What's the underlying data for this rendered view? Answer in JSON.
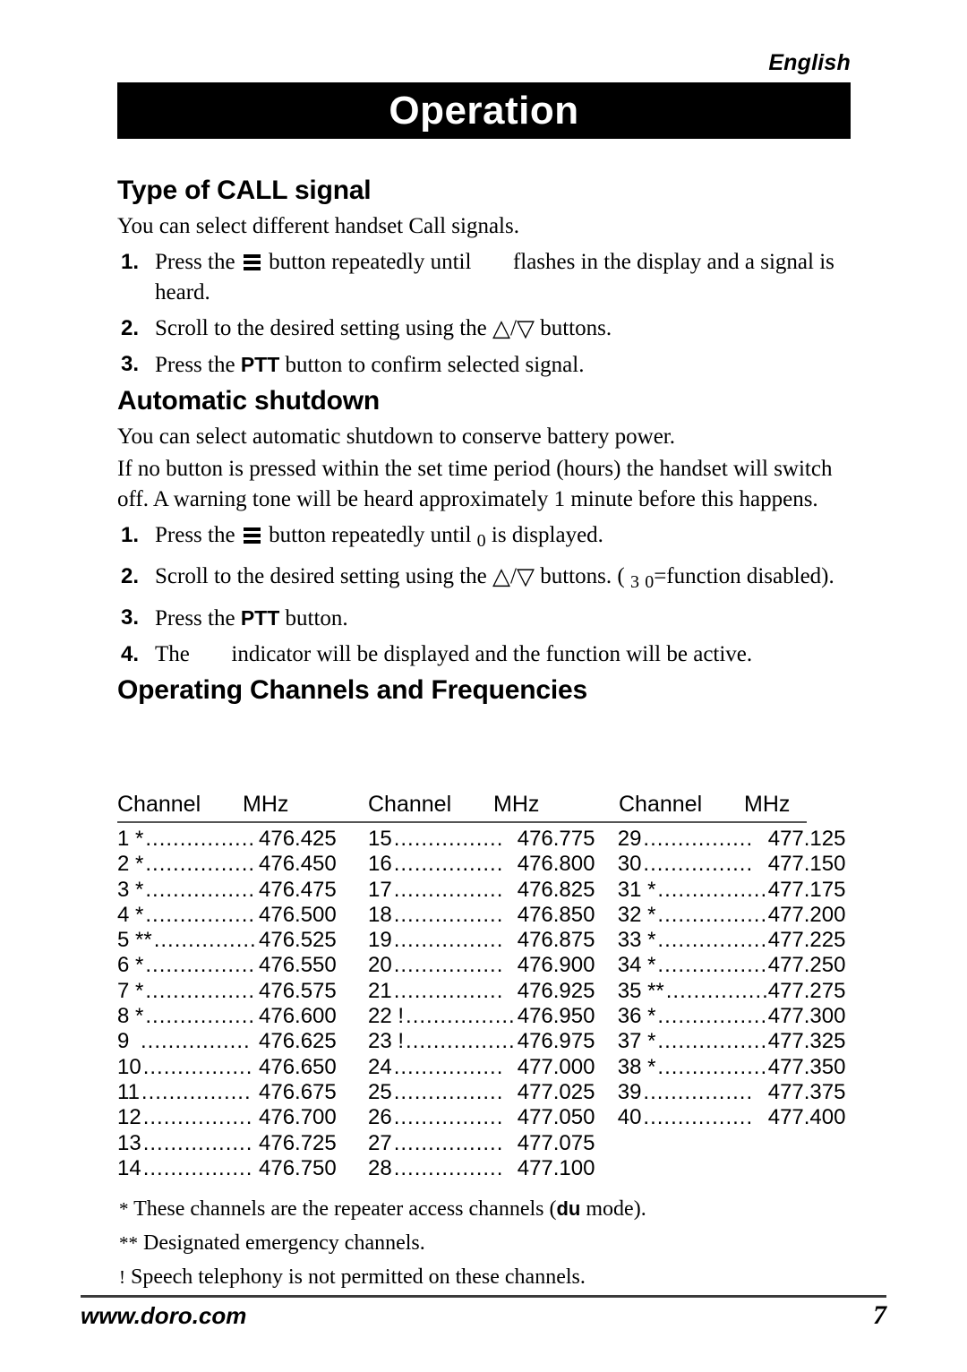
{
  "header": {
    "language_label": "English",
    "banner_title": "Operation"
  },
  "sections": [
    {
      "heading": "Type of CALL signal",
      "intro": "You can select different handset Call signals.",
      "steps": [
        {
          "num": "1.",
          "pre": "Press the",
          "icon": "menu-bars-icon",
          "mid": "button repeatedly until",
          "lcd": "",
          "post": "flashes in the display and a signal is heard."
        },
        {
          "num": "2.",
          "pre": "Scroll to the desired setting using the",
          "up": "△",
          "slash": "/",
          "down": "▽",
          "post": "buttons."
        },
        {
          "num": "3.",
          "pre": "Press the",
          "bold": "PTT",
          "post": "button to confirm selected signal."
        }
      ]
    },
    {
      "heading": "Automatic shutdown",
      "intro": "You can select automatic shutdown to conserve battery power.",
      "intro2": "If no button is pressed within the set time period (hours) the handset will switch off. A warning tone will be heard approximately 1 minute before this happens.",
      "steps": [
        {
          "num": "1.",
          "pre": "Press the",
          "icon": "menu-bars-icon",
          "mid": "button repeatedly until",
          "lcd": "0",
          "post": "is displayed."
        },
        {
          "num": "2.",
          "pre": "Scroll to the desired setting using the",
          "up": "△",
          "slash": "/",
          "down": "▽",
          "mid": "buttons. (",
          "lcd1": "3",
          "lcd2": "0",
          "post": "=function disabled)."
        },
        {
          "num": "3.",
          "pre": "Press the",
          "bold": "PTT",
          "post": "button."
        },
        {
          "num": "4.",
          "pre": "The",
          "lcd": "",
          "post": "indicator will be displayed and the function will be active."
        }
      ]
    }
  ],
  "table": {
    "heading": "Operating Channels and Frequencies",
    "columns": [
      {
        "channel_header": "Channel",
        "mhz_header": "MHz"
      },
      {
        "channel_header": "Channel",
        "mhz_header": "MHz"
      },
      {
        "channel_header": "Channel",
        "mhz_header": "MHz"
      }
    ],
    "dots": "................",
    "col1": [
      {
        "ch": "1 *",
        "mhz": "476.425"
      },
      {
        "ch": "2 *",
        "mhz": "476.450"
      },
      {
        "ch": "3 *",
        "mhz": "476.475"
      },
      {
        "ch": "4 *",
        "mhz": "476.500"
      },
      {
        "ch": "5 **",
        "mhz": "476.525"
      },
      {
        "ch": "6 *",
        "mhz": "476.550"
      },
      {
        "ch": "7 *",
        "mhz": "476.575"
      },
      {
        "ch": "8 *",
        "mhz": "476.600"
      },
      {
        "ch": "9",
        "mhz": "476.625"
      },
      {
        "ch": "10",
        "mhz": "476.650"
      },
      {
        "ch": "11",
        "mhz": "476.675"
      },
      {
        "ch": "12",
        "mhz": "476.700"
      },
      {
        "ch": "13",
        "mhz": "476.725"
      },
      {
        "ch": "14",
        "mhz": "476.750"
      }
    ],
    "col2": [
      {
        "ch": "15",
        "mhz": "476.775"
      },
      {
        "ch": "16",
        "mhz": "476.800"
      },
      {
        "ch": "17",
        "mhz": "476.825"
      },
      {
        "ch": "18",
        "mhz": "476.850"
      },
      {
        "ch": "19",
        "mhz": "476.875"
      },
      {
        "ch": "20",
        "mhz": "476.900"
      },
      {
        "ch": "21",
        "mhz": "476.925"
      },
      {
        "ch": "22 !",
        "mhz": "476.950"
      },
      {
        "ch": "23 !",
        "mhz": "476.975"
      },
      {
        "ch": "24",
        "mhz": "477.000"
      },
      {
        "ch": "25",
        "mhz": "477.025"
      },
      {
        "ch": "26",
        "mhz": "477.050"
      },
      {
        "ch": "27",
        "mhz": "477.075"
      },
      {
        "ch": "28",
        "mhz": "477.100"
      }
    ],
    "col3": [
      {
        "ch": "29",
        "mhz": "477.125"
      },
      {
        "ch": "30",
        "mhz": "477.150"
      },
      {
        "ch": "31 *",
        "mhz": "477.175"
      },
      {
        "ch": "32 *",
        "mhz": "477.200"
      },
      {
        "ch": "33 *",
        "mhz": "477.225"
      },
      {
        "ch": "34 *",
        "mhz": "477.250"
      },
      {
        "ch": "35 **",
        "mhz": "477.275"
      },
      {
        "ch": "36 *",
        "mhz": "477.300"
      },
      {
        "ch": "37 *",
        "mhz": "477.325"
      },
      {
        "ch": "38 *",
        "mhz": "477.350"
      },
      {
        "ch": "39",
        "mhz": "477.375"
      },
      {
        "ch": "40",
        "mhz": "477.400"
      }
    ]
  },
  "footnotes": {
    "one_mark": "*",
    "one_pre": "These channels are the repeater access channels (",
    "one_bold": "du",
    "one_post": "mode).",
    "two_mark": "**",
    "two_text": "Designated emergency channels.",
    "three_mark": "!",
    "three_text": "Speech telephony is not permitted on these channels."
  },
  "footer": {
    "website": "www.doro.com",
    "page_number": "7"
  }
}
